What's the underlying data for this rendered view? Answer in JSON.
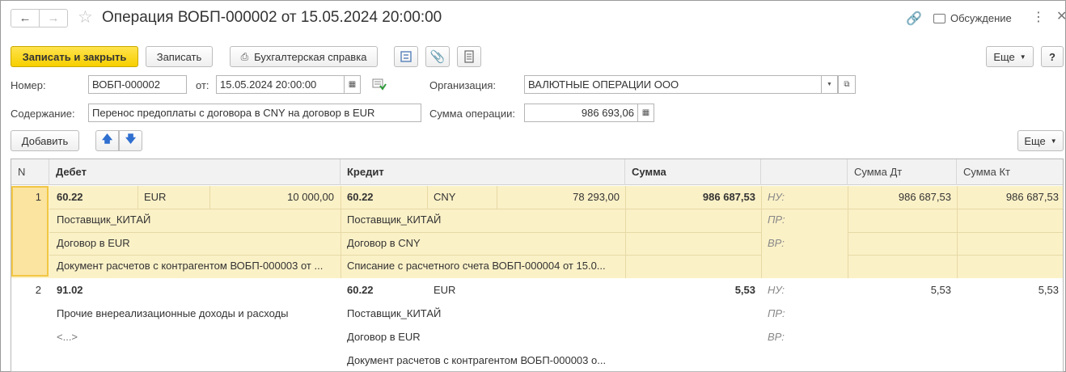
{
  "window": {
    "title": "Операция ВОБП-000002 от 15.05.2024 20:00:00",
    "discuss_label": "Обсуждение"
  },
  "icons": {
    "back": "arrow-left-icon",
    "forward": "arrow-right-icon",
    "favorite": "star-icon",
    "link": "link-icon",
    "discuss": "chat-bubble-icon",
    "more": "kebab-icon",
    "close": "close-icon"
  },
  "toolbar": {
    "save_close": "Записать и закрыть",
    "save": "Записать",
    "accounting_note": "Бухгалтерская справка",
    "more": "Еще",
    "help": "?"
  },
  "form": {
    "number_label": "Номер:",
    "number_value": "ВОБП-000002",
    "from_label": "от:",
    "date_value": "15.05.2024 20:00:00",
    "org_label": "Организация:",
    "org_value": "ВАЛЮТНЫЕ ОПЕРАЦИИ ООО",
    "content_label": "Содержание:",
    "content_value": "Перенос предоплаты с договора в CNY на договор в EUR",
    "sum_label": "Сумма операции:",
    "sum_value": "986 693,06"
  },
  "table_toolbar": {
    "add": "Добавить",
    "more": "Еще"
  },
  "table": {
    "headers": {
      "n": "N",
      "debit": "Дебет",
      "credit": "Кредит",
      "sum": "Сумма",
      "empty": "",
      "sum_dt": "Сумма Дт",
      "sum_kt": "Сумма Кт"
    },
    "rows": [
      {
        "n": "1",
        "debit_account": "60.22",
        "debit_currency": "EUR",
        "debit_cur_sum": "10 000,00",
        "debit_sub1": "Поставщик_КИТАЙ",
        "debit_sub2": "Договор в EUR",
        "debit_sub3": "Документ расчетов с контрагентом ВОБП-000003 от ...",
        "credit_account": "60.22",
        "credit_currency": "CNY",
        "credit_cur_sum": "78 293,00",
        "credit_sub1": "Поставщик_КИТАЙ",
        "credit_sub2": "Договор в CNY",
        "credit_sub3": "Списание с расчетного счета ВОБП-000004 от 15.0...",
        "sum": "986 687,53",
        "nu": "НУ:",
        "pr": "ПР:",
        "vr": "ВР:",
        "sum_dt": "986 687,53",
        "sum_kt": "986 687,53"
      },
      {
        "n": "2",
        "debit_account": "91.02",
        "debit_sub1": "Прочие внереализационные доходы и расходы",
        "debit_sub2": "<...>",
        "credit_account": "60.22",
        "credit_currency": "EUR",
        "credit_sub1": "Поставщик_КИТАЙ",
        "credit_sub2": "Договор в EUR",
        "credit_sub3": "Документ расчетов с контрагентом ВОБП-000003 о...",
        "sum": "5,53",
        "nu": "НУ:",
        "pr": "ПР:",
        "vr": "ВР:",
        "sum_dt": "5,53",
        "sum_kt": "5,53"
      }
    ]
  }
}
